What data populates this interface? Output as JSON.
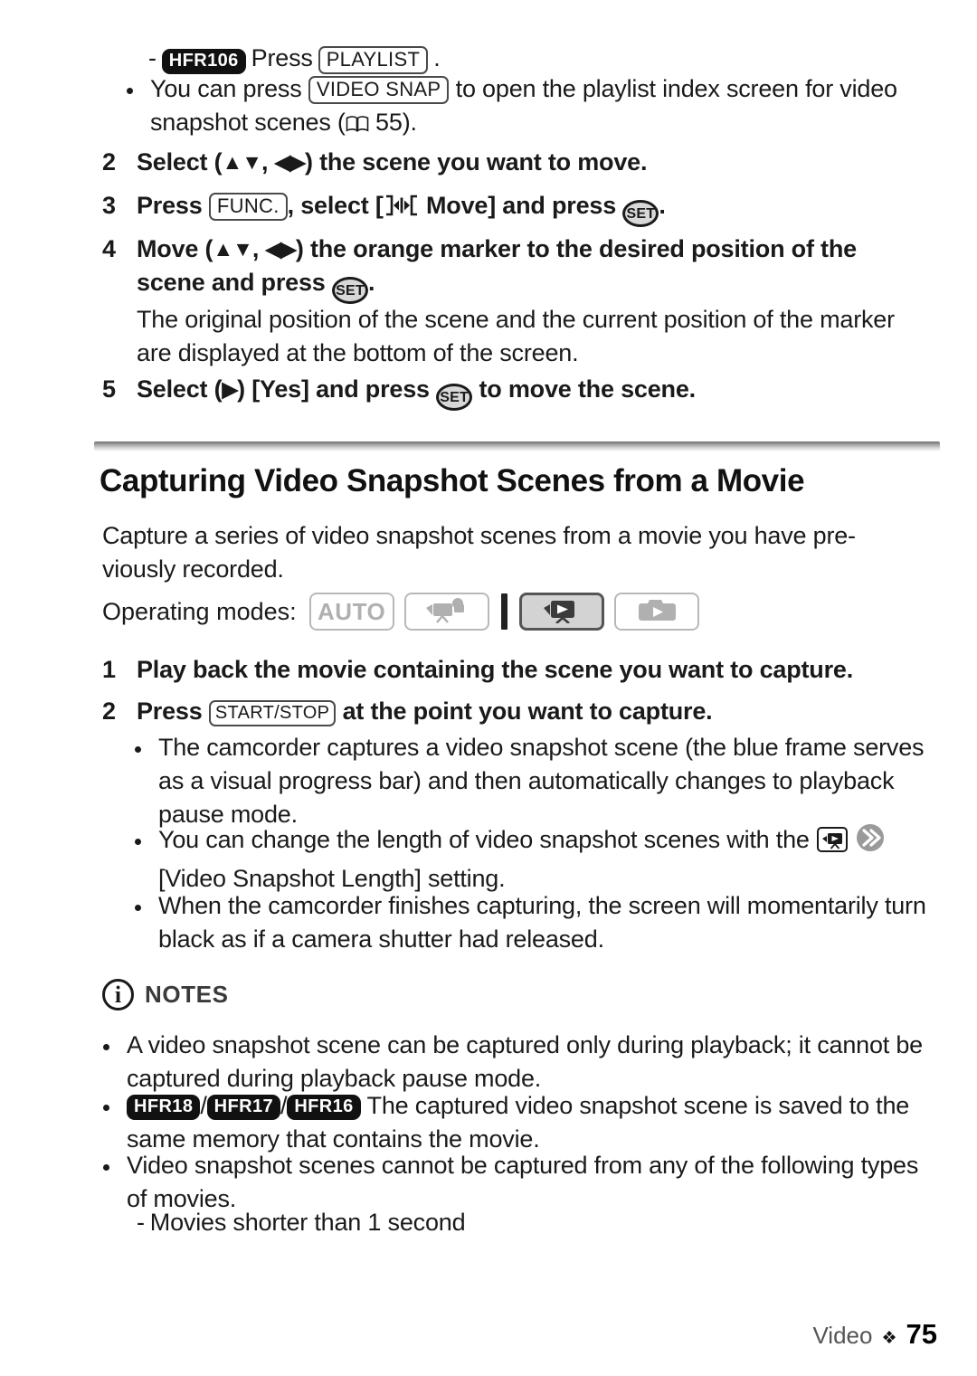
{
  "document": {
    "type": "camcorder-instruction-manual-page",
    "footer": {
      "section_label": "Video",
      "separator": "❖",
      "page_number": "75"
    }
  },
  "top_section": {
    "sub_item": {
      "dash": "-",
      "model_badge": "HFR106",
      "verb": "Press",
      "button": "PLAYLIST",
      "period": "."
    },
    "bullet": {
      "text_before": "You can press",
      "button": "VIDEO SNAP",
      "text_after": "to open the playlist index screen for video snapshot scenes (",
      "book_icon": "book-icon",
      "page_ref": "55",
      "text_end": ")."
    },
    "steps": [
      {
        "number": "2",
        "pre": "Select (",
        "arrows_1": "▲▼",
        "comma": ",",
        "arrows_2": "◀▶",
        "post": ") the scene you want to move."
      },
      {
        "number": "3",
        "pre": "Press",
        "button": "FUNC.",
        "mid": ", select [",
        "move_icon": "move-icon",
        "label": "Move] and press",
        "set_key": "SET",
        "post": "."
      },
      {
        "number": "4",
        "pre": "Move (",
        "arrows_1": "▲▼",
        "comma": ",",
        "arrows_2": "◀▶",
        "post": ") the orange marker to the desired position of the scene and press",
        "set_key": "SET",
        "end": "."
      }
    ],
    "step4_note": "The original position of the scene and the current position of the marker are displayed at the bottom of the screen.",
    "step5": {
      "number": "5",
      "pre": "Select (",
      "arrow": "▶",
      "mid": ") [Yes] and press",
      "set_key": "SET",
      "post": "to move the scene."
    }
  },
  "section": {
    "title": "Capturing Video Snapshot Scenes from a Movie",
    "intro": "Capture a series of video snapshot scenes from a movie you have pre-viously recorded.",
    "operating_modes": {
      "label": "Operating modes:",
      "items": [
        {
          "id": "auto",
          "label": "AUTO",
          "icon": "auto-text",
          "active": false
        },
        {
          "id": "movie-record",
          "label": "",
          "icon": "movie-camera-icon",
          "active": false
        },
        {
          "id": "separator",
          "label": "",
          "icon": "mode-separator",
          "active": false
        },
        {
          "id": "movie-playback",
          "label": "",
          "icon": "movie-playback-icon",
          "active": true
        },
        {
          "id": "photo-playback",
          "label": "",
          "icon": "photo-playback-icon",
          "active": false
        }
      ]
    },
    "steps": [
      {
        "number": "1",
        "text": "Play back the movie containing the scene you want to capture."
      },
      {
        "number": "2",
        "pre": "Press",
        "button": "START/STOP",
        "post": "at the point you want to capture."
      }
    ],
    "bullets": [
      {
        "text": "The camcorder captures a video snapshot scene (the blue frame serves as a visual progress bar) and then automatically changes to playback pause mode."
      },
      {
        "text_before": "You can change the length of video snapshot scenes with the",
        "icon_1": "movie-playback-icon",
        "icon_2": "double-chevron-icon",
        "text_after": "[Video Snapshot Length] setting."
      },
      {
        "text": "When the camcorder finishes capturing, the screen will momentarily turn black as if a camera shutter had released."
      }
    ]
  },
  "notes": {
    "icon": "info-icon",
    "label": "NOTES",
    "items": [
      {
        "text": "A video snapshot scene can be captured only during playback; it cannot be captured during playback pause mode."
      },
      {
        "badges": [
          "HFR18",
          "HFR17",
          "HFR16"
        ],
        "separator": "/",
        "text": "The captured video snapshot scene is saved to the same memory that contains the movie."
      },
      {
        "text": "Video snapshot scenes cannot be captured from any of the following types of movies.",
        "sub_items": [
          {
            "dash": "-",
            "text": "Movies shorter than 1 second"
          }
        ]
      }
    ]
  },
  "colors": {
    "text": "#1a1a1a",
    "badge_bg": "#111111",
    "badge_text": "#ffffff",
    "mode_inactive_border": "#b8b8b8",
    "mode_active_bg": "#d3d3d3",
    "mode_icon_gray": "#b0b0b0",
    "notes_label": "#3a3a3a"
  }
}
